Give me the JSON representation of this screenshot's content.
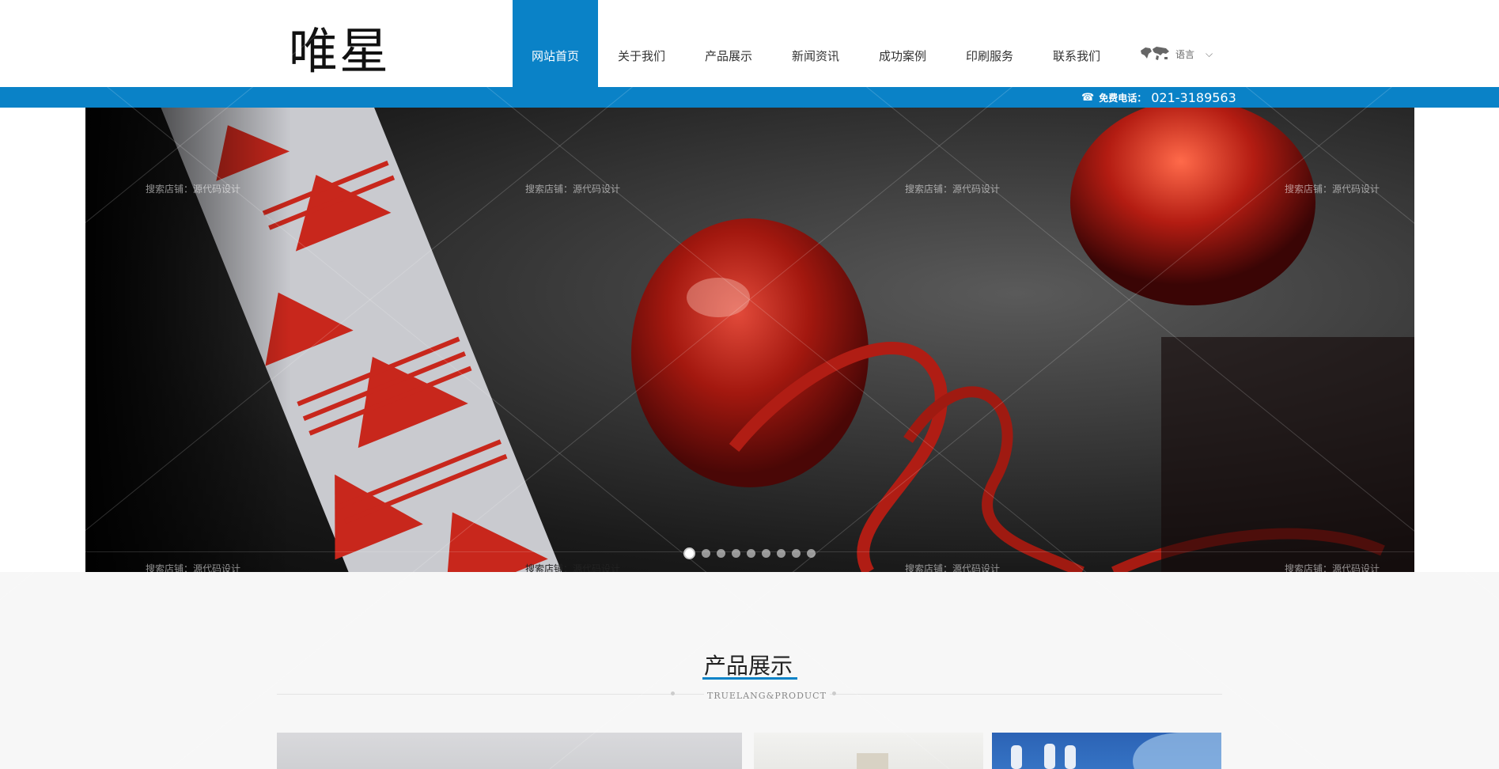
{
  "header": {
    "logo": "唯星",
    "nav": [
      {
        "label": "网站首页",
        "active": true
      },
      {
        "label": "关于我们",
        "active": false
      },
      {
        "label": "产品展示",
        "active": false
      },
      {
        "label": "新闻资讯",
        "active": false
      },
      {
        "label": "成功案例",
        "active": false
      },
      {
        "label": "印刷服务",
        "active": false
      },
      {
        "label": "联系我们",
        "active": false
      }
    ],
    "language_label": "语言",
    "phone_icon": "☎",
    "phone_label": "免费电话：",
    "phone_number": "021-3189563"
  },
  "banner": {
    "watermark": "搜索店铺：源代码设计",
    "slide_count": 9,
    "active_slide": 1
  },
  "products": {
    "title": "产品展示",
    "subtitle": "TRUELANG&PRODUCT"
  },
  "colors": {
    "accent": "#0a82c7"
  }
}
